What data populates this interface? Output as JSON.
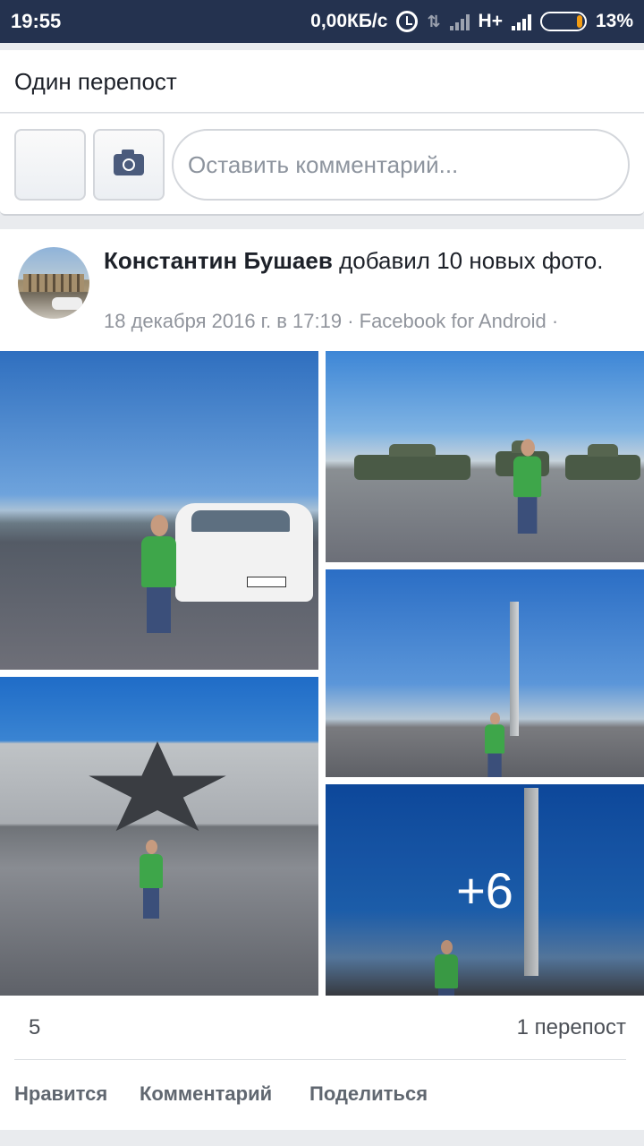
{
  "status_bar": {
    "time": "19:55",
    "speed": "0,00КБ/с",
    "network": "H+",
    "battery": "13%",
    "battery_level": 0.13
  },
  "reshare_header": {
    "title": "Один перепост"
  },
  "comment_composer": {
    "placeholder": "Оставить комментарий...",
    "camera_icon": "camera-icon"
  },
  "post": {
    "author": "Константин Бушаев",
    "action": "добавил 10 новых фото.",
    "meta": "18 декабря 2016 г. в 17:19 · Facebook for Android ·",
    "more_photos": "+6",
    "likes": "5",
    "shares": "1 перепост"
  },
  "actions": {
    "like": "Нравится",
    "comment": "Комментарий",
    "share": "Поделиться"
  },
  "colors": {
    "status_bar": "#24324f",
    "accent": "#4b5b7c",
    "text_secondary": "#90949c"
  }
}
